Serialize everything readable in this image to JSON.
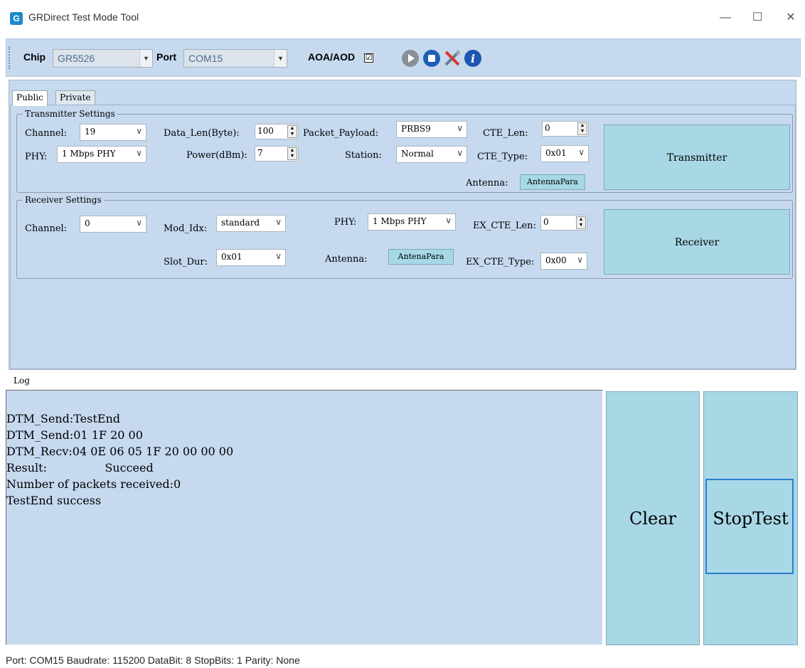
{
  "window": {
    "title": "GRDirect Test Mode Tool",
    "minimize": "—",
    "maximize": "☐",
    "close": "✕"
  },
  "toolbar": {
    "chip_label": "Chip",
    "chip_value": "GR5526",
    "port_label": "Port",
    "port_value": "COM15",
    "aoa_label": "AOA/AOD",
    "aoa_checked": "☑",
    "icons": [
      "play-icon",
      "stop-icon",
      "settings-tools-icon",
      "info-icon"
    ],
    "info_glyph": "i"
  },
  "tabs": {
    "public": "Public",
    "private": "Private"
  },
  "transmitter": {
    "title": "Transmitter Settings",
    "channel_label": "Channel:",
    "channel_value": "19",
    "phy_label": "PHY:",
    "phy_value": "1 Mbps PHY",
    "data_len_label": "Data_Len(Byte):",
    "data_len_value": "100",
    "power_label": "Power(dBm):",
    "power_value": "7",
    "payload_label": "Packet_Payload:",
    "payload_value": "PRBS9",
    "station_label": "Station:",
    "station_value": "Normal",
    "cte_len_label": "CTE_Len:",
    "cte_len_value": "0",
    "cte_type_label": "CTE_Type:",
    "cte_type_value": "0x01",
    "antenna_label": "Antenna:",
    "antenna_button": "AntennaPara",
    "button": "Transmitter"
  },
  "receiver": {
    "title": "Receiver Settings",
    "channel_label": "Channel:",
    "channel_value": "0",
    "mod_idx_label": "Mod_Idx:",
    "mod_idx_value": "standard",
    "slot_dur_label": "Slot_Dur:",
    "slot_dur_value": "0x01",
    "phy_label": "PHY:",
    "phy_value": "1 Mbps PHY",
    "antenna_label": "Antenna:",
    "antenna_button": "AntenaPara",
    "ex_cte_len_label": "EX_CTE_Len:",
    "ex_cte_len_value": "0",
    "ex_cte_type_label": "EX_CTE_Type:",
    "ex_cte_type_value": "0x00",
    "button": "Receiver"
  },
  "log": {
    "label": "Log",
    "lines": [
      "DTM_Send:TestEnd",
      "DTM_Send:01 1F 20 00",
      "DTM_Recv:04 0E 06 05 1F 20 00 00 00",
      "Result:                Succeed",
      "Number of packets received:0",
      "TestEnd success"
    ],
    "clear_button": "Clear",
    "stoptest_button": "StopTest"
  },
  "status": {
    "text": "Port: COM15  Baudrate: 115200  DataBit: 8  StopBits: 1  Parity: None"
  }
}
